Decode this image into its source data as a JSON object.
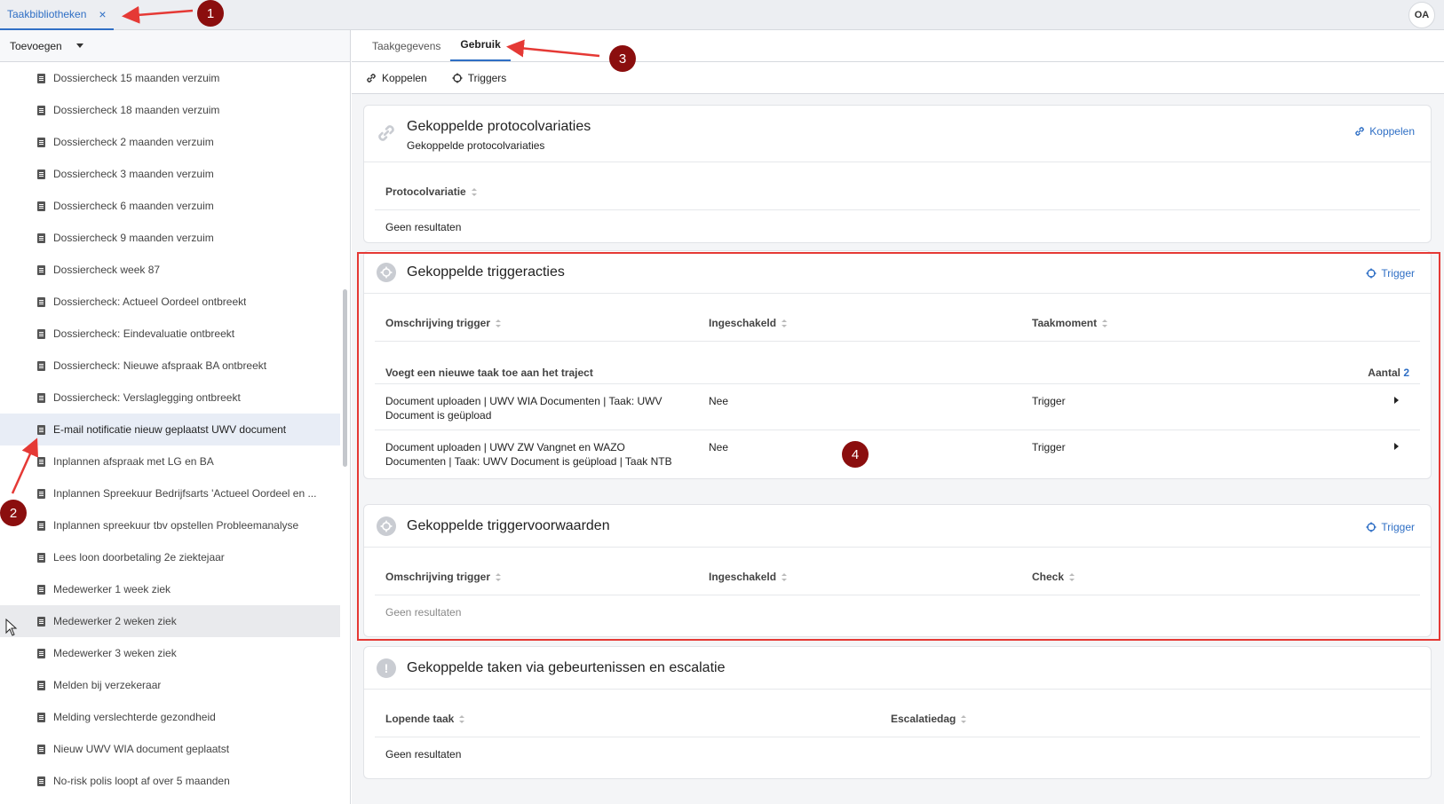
{
  "topbar": {
    "tab_label": "Taakbibliotheken",
    "close_glyph": "×",
    "avatar_initials": "OA"
  },
  "sidebar": {
    "add_label": "Toevoegen",
    "items": [
      "Dossiercheck 15 maanden verzuim",
      "Dossiercheck 18 maanden verzuim",
      "Dossiercheck 2 maanden verzuim",
      "Dossiercheck 3 maanden verzuim",
      "Dossiercheck 6 maanden verzuim",
      "Dossiercheck 9 maanden verzuim",
      "Dossiercheck week 87",
      "Dossiercheck: Actueel Oordeel ontbreekt",
      "Dossiercheck: Eindevaluatie ontbreekt",
      "Dossiercheck: Nieuwe afspraak BA ontbreekt",
      "Dossiercheck: Verslaglegging ontbreekt",
      "E-mail notificatie nieuw geplaatst UWV document",
      "Inplannen afspraak met LG en BA",
      "Inplannen Spreekuur Bedrijfsarts 'Actueel Oordeel en ...",
      "Inplannen spreekuur tbv opstellen Probleemanalyse",
      "Lees loon doorbetaling 2e ziektejaar",
      "Medewerker 1 week ziek",
      "Medewerker 2 weken ziek",
      "Medewerker 3 weken ziek",
      "Melden bij verzekeraar",
      "Melding verslechterde gezondheid",
      "Nieuw UWV WIA document geplaatst",
      "No-risk polis loopt af over 5 maanden"
    ],
    "selected_index": 11,
    "hovered_index": 17
  },
  "main": {
    "tabs": [
      "Taakgegevens",
      "Gebruik"
    ],
    "active_tab": "Gebruik",
    "subbar": {
      "koppelen": "Koppelen",
      "triggers": "Triggers"
    },
    "protocol": {
      "title": "Gekoppelde protocolvariaties",
      "subtitle": "Gekoppelde protocolvariaties",
      "action": "Koppelen",
      "column": "Protocolvariatie",
      "empty": "Geen resultaten"
    },
    "triggeracties": {
      "title": "Gekoppelde triggeracties",
      "action": "Trigger",
      "columns": [
        "Omschrijving trigger",
        "Ingeschakeld",
        "Taakmoment"
      ],
      "group_label": "Voegt een nieuwe taak toe aan het traject",
      "count_label": "Aantal",
      "count_value": "2",
      "rows": [
        {
          "desc1": "Document uploaden | UWV WIA Documenten | Taak: UWV",
          "desc2": "Document is geüpload",
          "enabled": "Nee",
          "moment": "Trigger"
        },
        {
          "desc1": "Document uploaden | UWV ZW Vangnet en WAZO",
          "desc2": "Documenten | Taak: UWV Document is geüpload | Taak NTB",
          "enabled": "Nee",
          "moment": "Trigger"
        }
      ]
    },
    "triggervoorwaarden": {
      "title": "Gekoppelde triggervoorwaarden",
      "action": "Trigger",
      "columns": [
        "Omschrijving trigger",
        "Ingeschakeld",
        "Check"
      ],
      "empty": "Geen resultaten"
    },
    "escalatie": {
      "title": "Gekoppelde taken via gebeurtenissen en escalatie",
      "columns": [
        "Lopende taak",
        "Escalatiedag"
      ],
      "empty": "Geen resultaten"
    }
  },
  "annotations": {
    "badge1": "1",
    "badge2": "2",
    "badge3": "3",
    "badge4": "4"
  },
  "colors": {
    "accent": "#2f6fc5",
    "annotation_red": "#e53935",
    "badge_red": "#8b0e0e"
  }
}
